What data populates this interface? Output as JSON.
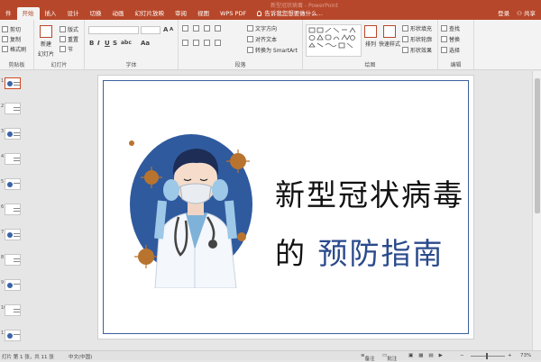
{
  "titlebar": {
    "tabs": [
      "件",
      "开始",
      "插入",
      "设计",
      "切换",
      "动画",
      "幻灯片放映",
      "审阅",
      "视图",
      "WPS PDF"
    ],
    "tell_me": "告诉我您想要做什么...",
    "doc_title": "新型冠状病毒 - PowerPoint",
    "login": "登录",
    "share": "共享",
    "accent_color": "#b7472a"
  },
  "ribbon": {
    "clipboard": {
      "label": "剪贴板",
      "cut": "剪切",
      "copy": "复制",
      "format_painter": "格式刷"
    },
    "slides": {
      "label": "幻灯片",
      "new_slide": "新建",
      "new_slide_2": "幻灯片",
      "layout": "版式",
      "reset": "重置",
      "section": "节"
    },
    "font": {
      "label": "字体",
      "bold": "B",
      "italic": "I",
      "underline": "U",
      "strike": "S",
      "shadow": "abc",
      "size_up": "A",
      "size_down": "A",
      "case": "Aa"
    },
    "paragraph": {
      "label": "段落",
      "text_direction": "文字方向",
      "align_text": "对齐文本",
      "convert_smartart": "转换为 SmartArt"
    },
    "drawing": {
      "label": "绘图",
      "arrange": "排列",
      "quick_styles": "快速样式",
      "shape_fill": "形状填充",
      "shape_outline": "形状轮廓",
      "shape_effects": "形状效果"
    },
    "editing": {
      "label": "编辑",
      "find": "查找",
      "replace": "替换",
      "select": "选择"
    }
  },
  "thumbnails": {
    "numbers": [
      "1",
      "2",
      "3",
      "4",
      "5",
      "6",
      "7",
      "8",
      "9",
      "10",
      "11"
    ],
    "selected_index": 1
  },
  "slide": {
    "line1": "新型冠状病毒",
    "line2_a": "的",
    "line2_b": "预防指南",
    "title_color": "#111111",
    "accent_color": "#2a4a8c"
  },
  "status": {
    "slide_info": "灯片 第 1 张，共 11 张",
    "language": "中文(中国)",
    "notes": "备注",
    "comments": "批注",
    "zoom": "73%"
  }
}
